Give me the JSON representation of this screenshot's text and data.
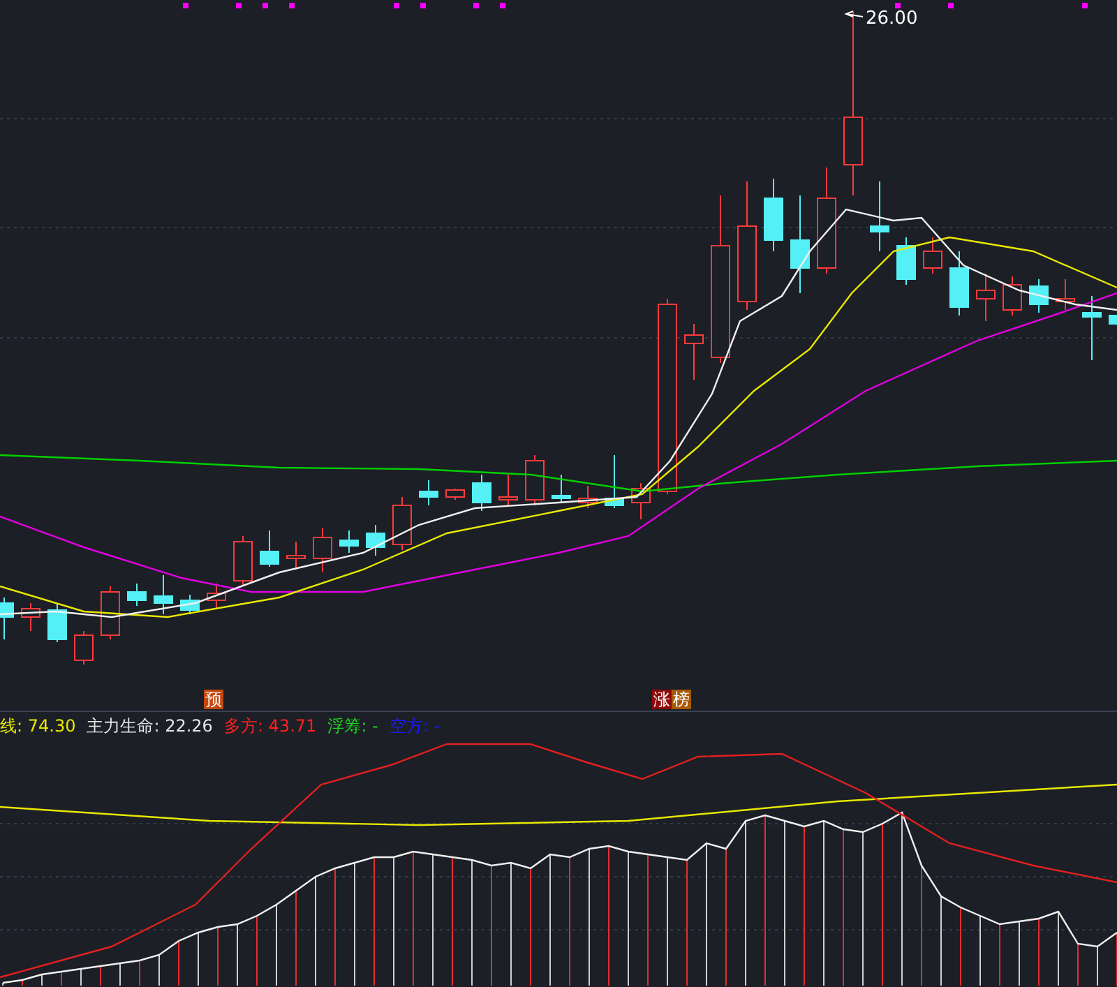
{
  "price_chart": {
    "high_label": "26.00",
    "signals": [
      {
        "chars": [
          {
            "text": "预",
            "color": "#c4470e"
          }
        ]
      },
      {
        "chars": [
          {
            "text": "涨",
            "color": "#8e0a0a"
          },
          {
            "text": "榜",
            "color": "#a85a06"
          }
        ]
      }
    ]
  },
  "indicator_panel": {
    "legend": [
      {
        "text": "线: 74.30",
        "color": "#e8e800"
      },
      {
        "text": "主力生命: 22.26",
        "color": "#e6e6e6"
      },
      {
        "text": "多方: 43.71",
        "color": "#ff2020"
      },
      {
        "text": "浮筹: -",
        "color": "#20d020"
      },
      {
        "text": "空方: -",
        "color": "#1a1aff"
      }
    ]
  }
}
